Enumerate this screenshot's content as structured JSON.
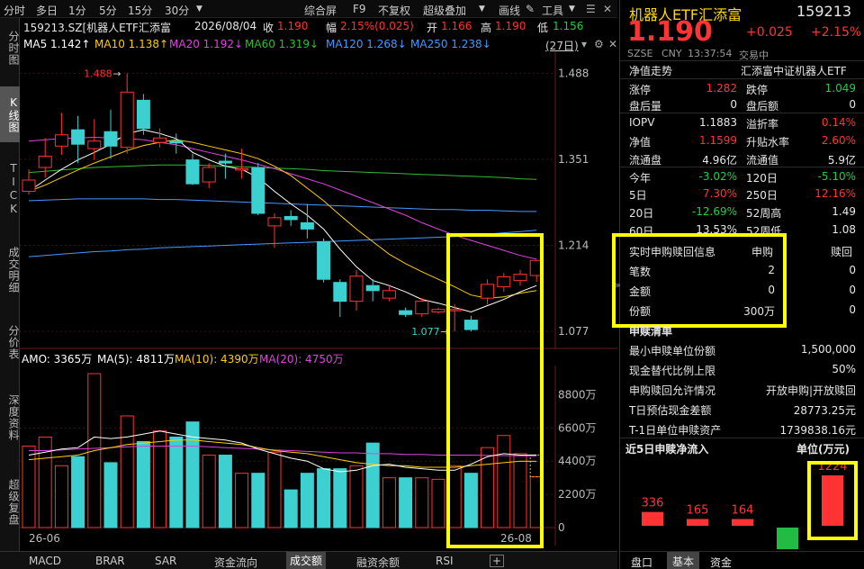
{
  "toolbar": {
    "timeframes": [
      "分时",
      "多日",
      "1分",
      "5分",
      "15分",
      "30分"
    ],
    "timeframe_dropdown": "30分",
    "menu": [
      "综合屏",
      "F9",
      "不复权",
      "超级叠加",
      "画线",
      "工具"
    ]
  },
  "left_nav": [
    "分时图",
    "K线图",
    "TICK",
    "成交明细",
    "分价表",
    "深度资料",
    "超级复盘"
  ],
  "left_nav_active": "K线图",
  "info": {
    "code": "159213.SZ[机器人ETF汇添富",
    "date": "2026/08/04",
    "close_label": "收",
    "close": "1.190",
    "change_label": "幅",
    "change": "2.15%(0.025)",
    "open_label": "开",
    "open": "1.166",
    "high_label": "高",
    "high": "1.190",
    "low_label": "低",
    "low": "1.156"
  },
  "ma": {
    "ma5": "MA5 1.142↑",
    "ma10": "MA10 1.138↑",
    "ma20": "MA20 1.192↓",
    "ma60": "MA60 1.319↓",
    "ma120": "MA120 1.268↓",
    "ma250": "MA250 1.238↓",
    "window": "(27日)"
  },
  "colors": {
    "up": "#ff3333",
    "down": "#3cd0d0",
    "ma5": "#ffffff",
    "ma10": "#ffcc00",
    "ma20": "#dd44dd",
    "ma60": "#33bb33",
    "ma120": "#4499ff",
    "ma250": "#ffffff",
    "highlight": "#ffff00"
  },
  "chart_data": {
    "type": "candlestick",
    "price_axis": [
      "1.488",
      "1.351",
      "1.214",
      "1.077"
    ],
    "ylim": [
      1.06,
      1.51
    ],
    "high_label": "1.488",
    "low_label": "1.077",
    "candles": [
      {
        "o": 1.3,
        "c": 1.318,
        "h": 1.335,
        "l": 1.295
      },
      {
        "o": 1.338,
        "c": 1.356,
        "h": 1.385,
        "l": 1.322
      },
      {
        "o": 1.372,
        "c": 1.39,
        "h": 1.425,
        "l": 1.358
      },
      {
        "o": 1.398,
        "c": 1.375,
        "h": 1.42,
        "l": 1.345
      },
      {
        "o": 1.368,
        "c": 1.38,
        "h": 1.415,
        "l": 1.35
      },
      {
        "o": 1.395,
        "c": 1.372,
        "h": 1.43,
        "l": 1.352
      },
      {
        "o": 1.37,
        "c": 1.458,
        "h": 1.488,
        "l": 1.36
      },
      {
        "o": 1.445,
        "c": 1.4,
        "h": 1.455,
        "l": 1.39
      },
      {
        "o": 1.378,
        "c": 1.385,
        "h": 1.4,
        "l": 1.37
      },
      {
        "o": 1.38,
        "c": 1.377,
        "h": 1.392,
        "l": 1.36
      },
      {
        "o": 1.35,
        "c": 1.312,
        "h": 1.36,
        "l": 1.31
      },
      {
        "o": 1.315,
        "c": 1.338,
        "h": 1.345,
        "l": 1.305
      },
      {
        "o": 1.348,
        "c": 1.345,
        "h": 1.36,
        "l": 1.32
      },
      {
        "o": 1.335,
        "c": 1.336,
        "h": 1.368,
        "l": 1.32
      },
      {
        "o": 1.338,
        "c": 1.265,
        "h": 1.345,
        "l": 1.262
      },
      {
        "o": 1.245,
        "c": 1.258,
        "h": 1.265,
        "l": 1.21
      },
      {
        "o": 1.26,
        "c": 1.255,
        "h": 1.27,
        "l": 1.245
      },
      {
        "o": 1.25,
        "c": 1.24,
        "h": 1.28,
        "l": 1.225
      },
      {
        "o": 1.22,
        "c": 1.16,
        "h": 1.225,
        "l": 1.155
      },
      {
        "o": 1.155,
        "c": 1.125,
        "h": 1.16,
        "l": 1.1
      },
      {
        "o": 1.125,
        "c": 1.165,
        "h": 1.175,
        "l": 1.11
      },
      {
        "o": 1.15,
        "c": 1.142,
        "h": 1.16,
        "l": 1.125
      },
      {
        "o": 1.13,
        "c": 1.142,
        "h": 1.15,
        "l": 1.125
      },
      {
        "o": 1.11,
        "c": 1.104,
        "h": 1.115,
        "l": 1.1
      },
      {
        "o": 1.105,
        "c": 1.125,
        "h": 1.13,
        "l": 1.1
      },
      {
        "o": 1.108,
        "c": 1.112,
        "h": 1.115,
        "l": 1.105
      },
      {
        "o": 1.11,
        "c": 1.112,
        "h": 1.12,
        "l": 1.077
      },
      {
        "o": 1.095,
        "c": 1.08,
        "h": 1.102,
        "l": 1.077
      },
      {
        "o": 1.13,
        "c": 1.152,
        "h": 1.16,
        "l": 1.12
      },
      {
        "o": 1.148,
        "c": 1.164,
        "h": 1.17,
        "l": 1.14
      },
      {
        "o": 1.158,
        "c": 1.168,
        "h": 1.175,
        "l": 1.15
      },
      {
        "o": 1.166,
        "c": 1.19,
        "h": 1.19,
        "l": 1.156
      }
    ],
    "ma_lines": {
      "ma5": [
        1.3,
        1.318,
        1.335,
        1.35,
        1.362,
        1.375,
        1.392,
        1.398,
        1.392,
        1.384,
        1.362,
        1.35,
        1.34,
        1.335,
        1.322,
        1.3,
        1.28,
        1.262,
        1.24,
        1.208,
        1.18,
        1.158,
        1.15,
        1.14,
        1.128,
        1.122,
        1.115,
        1.108,
        1.118,
        1.128,
        1.14,
        1.15
      ],
      "ma10": [
        1.3,
        1.31,
        1.322,
        1.334,
        1.345,
        1.355,
        1.365,
        1.373,
        1.378,
        1.382,
        1.378,
        1.372,
        1.366,
        1.36,
        1.352,
        1.34,
        1.325,
        1.305,
        1.285,
        1.262,
        1.24,
        1.22,
        1.2,
        1.185,
        1.172,
        1.16,
        1.148,
        1.135,
        1.13,
        1.132,
        1.138,
        1.142
      ],
      "ma20": [
        1.38,
        1.382,
        1.384,
        1.385,
        1.386,
        1.385,
        1.384,
        1.382,
        1.378,
        1.374,
        1.368,
        1.362,
        1.356,
        1.35,
        1.343,
        1.336,
        1.328,
        1.32,
        1.312,
        1.302,
        1.292,
        1.282,
        1.272,
        1.262,
        1.25,
        1.24,
        1.23,
        1.222,
        1.214,
        1.206,
        1.198,
        1.192
      ],
      "ma60": [
        1.33,
        1.332,
        1.334,
        1.336,
        1.338,
        1.339,
        1.34,
        1.341,
        1.342,
        1.342,
        1.342,
        1.341,
        1.34,
        1.339,
        1.338,
        1.337,
        1.336,
        1.335,
        1.333,
        1.332,
        1.331,
        1.33,
        1.329,
        1.328,
        1.327,
        1.326,
        1.325,
        1.324,
        1.323,
        1.322,
        1.32,
        1.319
      ],
      "ma120": [
        1.285,
        1.286,
        1.287,
        1.288,
        1.288,
        1.288,
        1.288,
        1.288,
        1.287,
        1.287,
        1.286,
        1.285,
        1.284,
        1.283,
        1.282,
        1.281,
        1.28,
        1.279,
        1.278,
        1.277,
        1.276,
        1.275,
        1.274,
        1.273,
        1.272,
        1.271,
        1.271,
        1.27,
        1.27,
        1.269,
        1.268,
        1.268
      ],
      "ma250": [
        1.196,
        1.198,
        1.2,
        1.202,
        1.204,
        1.205,
        1.207,
        1.208,
        1.21,
        1.211,
        1.212,
        1.213,
        1.214,
        1.215,
        1.216,
        1.217,
        1.218,
        1.219,
        1.22,
        1.221,
        1.222,
        1.223,
        1.224,
        1.225,
        1.226,
        1.227,
        1.228,
        1.23,
        1.232,
        1.234,
        1.236,
        1.238
      ]
    },
    "volume": {
      "header": {
        "amo": "AMO: 3365万",
        "ma5": "MA(5): 4811万",
        "ma10": "MA(10): 4390万",
        "ma20": "MA(20): 4750万"
      },
      "axis": [
        "8800万",
        "6600万",
        "4400万",
        "2200万",
        "0"
      ],
      "ylim": [
        0,
        10500
      ],
      "bars": [
        5400,
        6000,
        4100,
        4700,
        10200,
        4300,
        7400,
        5700,
        6400,
        6000,
        7000,
        4800,
        4800,
        3600,
        3600,
        5000,
        2500,
        3600,
        3900,
        3900,
        4100,
        5600,
        3300,
        3300,
        3300,
        3200,
        4100,
        3600,
        5300,
        6100,
        4900,
        3365
      ],
      "ma5": [
        4800,
        5000,
        5200,
        5300,
        6000,
        5900,
        6000,
        6200,
        6400,
        6200,
        6000,
        5900,
        5800,
        5600,
        5200,
        4900,
        4600,
        4400,
        3900,
        3700,
        3800,
        4100,
        4200,
        4000,
        3900,
        3800,
        3800,
        4200,
        4700,
        4900,
        4800,
        4811
      ],
      "ma10": [
        4500,
        4600,
        4700,
        4800,
        5100,
        5300,
        5500,
        5600,
        5700,
        5800,
        5800,
        5700,
        5600,
        5500,
        5300,
        5100,
        5000,
        4900,
        4700,
        4500,
        4300,
        4200,
        4100,
        4100,
        4000,
        4000,
        4000,
        4100,
        4200,
        4300,
        4400,
        4390
      ],
      "ma20": [
        5100,
        5100,
        5150,
        5200,
        5250,
        5300,
        5350,
        5400,
        5400,
        5400,
        5400,
        5350,
        5300,
        5250,
        5200,
        5150,
        5100,
        5050,
        5000,
        4950,
        4950,
        4900,
        4900,
        4850,
        4850,
        4800,
        4800,
        4800,
        4780,
        4770,
        4760,
        4750
      ]
    },
    "x_labels": [
      "26-06",
      "26-08"
    ]
  },
  "bottom_tabs": [
    "MACD",
    "BRAR",
    "SAR",
    "资金流向",
    "成交额",
    "融资余额",
    "RSI"
  ],
  "bottom_active": "成交额",
  "right": {
    "name": "机器人ETF汇添富",
    "code": "159213",
    "price": "1.190",
    "change": "+0.025",
    "change_pct": "+2.15%",
    "market": "SZSE",
    "currency": "CNY",
    "time": "13:37:54",
    "status": "交易中",
    "nav_trend_label": "净值走势",
    "fund_company": "汇添富中证机器人ETF",
    "rows": [
      [
        "涨停",
        "1.282",
        "跌停",
        "1.049"
      ],
      [
        "盘后量",
        "0",
        "盘后额",
        "0"
      ],
      [
        "IOPV",
        "1.1883",
        "溢折率",
        "0.14%"
      ],
      [
        "净值",
        "1.1599",
        "升贴水率",
        "2.60%"
      ],
      [
        "流通盘",
        "4.96亿",
        "流通值",
        "5.9亿"
      ],
      [
        "今年",
        "-3.02%",
        "120日",
        "-5.10%"
      ],
      [
        "5日",
        "7.30%",
        "250日",
        "12.16%"
      ],
      [
        "20日",
        "-12.69%",
        "52周高",
        "1.49"
      ],
      [
        "60日",
        "13.53%",
        "52周低",
        "1.08"
      ]
    ],
    "realtime": {
      "title": "实时申购赎回信息",
      "col_sub": "申购",
      "col_red": "赎回",
      "rows": [
        [
          "笔数",
          "2",
          "0"
        ],
        [
          "金额",
          "0",
          "0"
        ],
        [
          "份额",
          "300万",
          "0"
        ]
      ]
    },
    "list_title": "申赎清单",
    "list": [
      [
        "最小申赎单位份额",
        "1,500,000"
      ],
      [
        "现金替代比例上限",
        "50%"
      ],
      [
        "申购赎回允许情况",
        "开放申购|开放赎回"
      ],
      [
        "T日预估现金差额",
        "28773.25元"
      ],
      [
        "T-1日单位申赎资产",
        "1739838.16元"
      ]
    ],
    "flow_title": "近5日申赎净流入",
    "flow_unit": "单位(万元)",
    "flow": [
      {
        "label": "336",
        "value": 336
      },
      {
        "label": "165",
        "value": 165
      },
      {
        "label": "164",
        "value": 164
      },
      {
        "label": "",
        "value": -120
      },
      {
        "label": "1224",
        "value": 1224
      }
    ],
    "tabs": [
      "盘口",
      "基本",
      "资金"
    ],
    "active_tab": "基本"
  }
}
